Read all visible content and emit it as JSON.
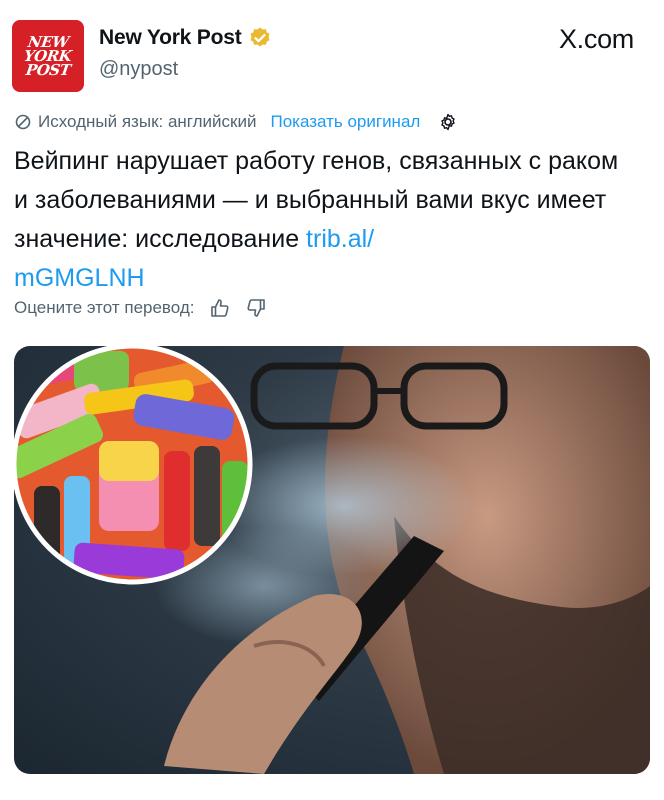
{
  "author": {
    "logo_lines": [
      "NEW",
      "YORK",
      "POST"
    ],
    "name": "New York Post",
    "handle": "@nypost",
    "verified_color": "#e8b931",
    "brand_color": "#d62027"
  },
  "site_label": "X.com",
  "translation": {
    "source_label": "Исходный язык: английский",
    "show_original": "Показать оригинал"
  },
  "tweet": {
    "text": "Вейпинг нарушает работу генов, связанных с раком и заболеваниями — и выбранный вами вкус имеет значение: исследование ",
    "link": "trib.al/\nmGMGLNH"
  },
  "rating": {
    "label": "Оцените этот перевод:"
  },
  "media": {
    "description_icon": "photo-man-vaping-with-inset-disposable-vapes"
  },
  "colors": {
    "link": "#1d9bf0",
    "secondary_text": "#536471",
    "primary_text": "#0f1419"
  }
}
